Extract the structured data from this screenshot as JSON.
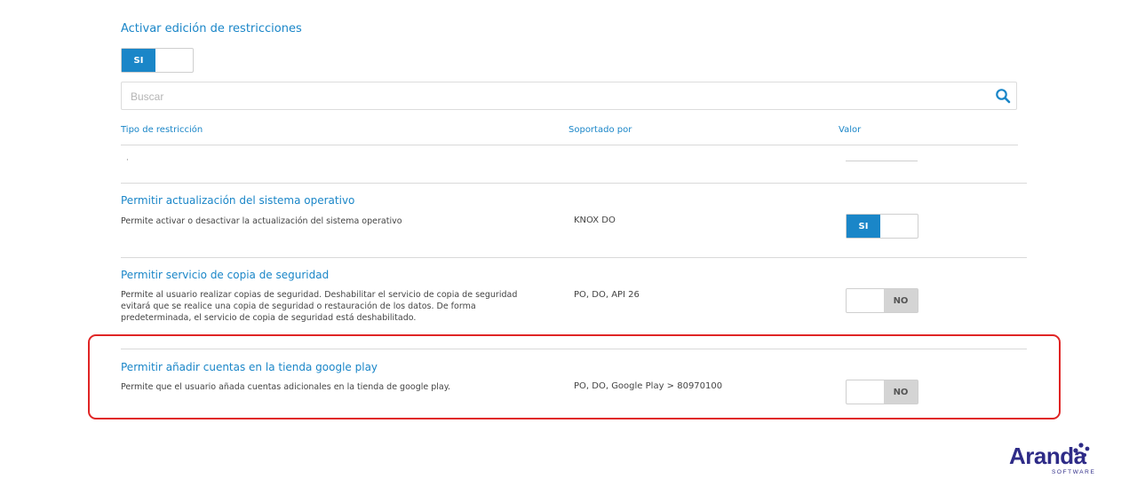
{
  "header": {
    "title": "Activar edición de restricciones",
    "toggle_label": "SI"
  },
  "search": {
    "placeholder": "Buscar",
    "icon": "search-icon"
  },
  "table": {
    "columns": [
      "Tipo de restricción",
      "Soportado por",
      "Valor"
    ],
    "placeholder_dot": "·",
    "rows": [
      {
        "title": "Permitir actualización del sistema operativo",
        "description": "Permite activar o desactivar la actualización del sistema operativo",
        "supported_by": "KNOX DO",
        "value": "SI"
      },
      {
        "title": "Permitir servicio de copia de seguridad",
        "description": "Permite al usuario realizar copias de seguridad. Deshabilitar el servicio de copia de seguridad evitará que se realice una copia de seguridad o restauración de los datos. De forma predeterminada, el servicio de copia de seguridad está deshabilitado.",
        "supported_by": "PO, DO, API 26",
        "value": "NO"
      },
      {
        "title": "Permitir añadir cuentas en la tienda google play",
        "description": "Permite que el usuario añada cuentas adicionales en la tienda de google play.",
        "supported_by": "PO, DO, Google Play > 80970100",
        "value": "NO"
      }
    ]
  },
  "logo": {
    "name": "Aranda",
    "tagline": "SOFTWARE"
  },
  "colors": {
    "accent": "#1a86c8",
    "highlight": "#e02525",
    "brand": "#2e2b87",
    "toggle_off": "#d4d4d4"
  }
}
